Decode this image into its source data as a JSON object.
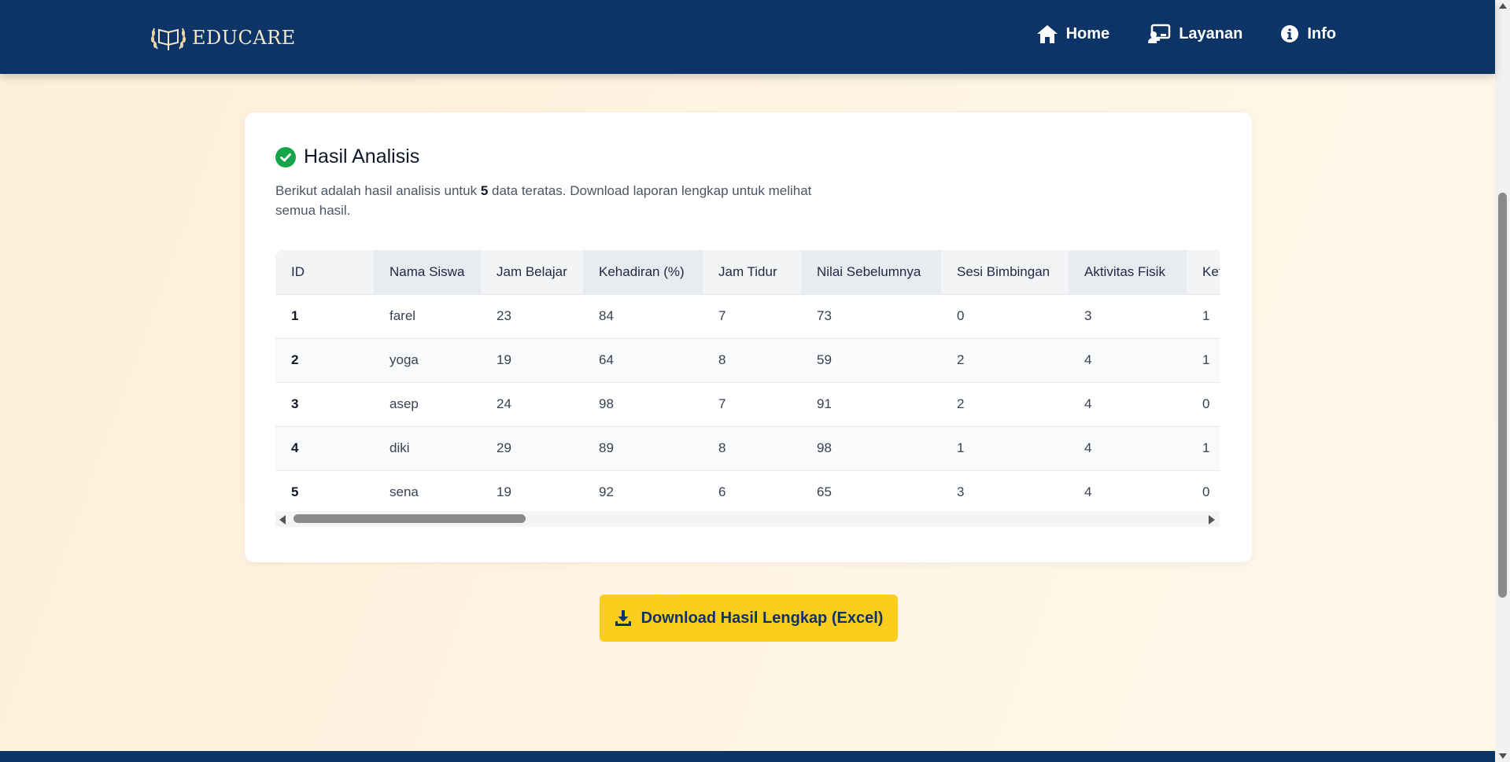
{
  "brand": {
    "name": "EDUCARE"
  },
  "nav": [
    {
      "label": "Home",
      "icon": "home-icon"
    },
    {
      "label": "Layanan",
      "icon": "teacher-board-icon"
    },
    {
      "label": "Info",
      "icon": "info-circle-icon"
    }
  ],
  "result": {
    "title": "Hasil Analisis",
    "desc_prefix": "Berikut adalah hasil analisis untuk ",
    "desc_count": "5",
    "desc_suffix": " data teratas. Download laporan lengkap untuk melihat semua hasil."
  },
  "table": {
    "headers": [
      "ID",
      "Nama Siswa",
      "Jam Belajar",
      "Kehadiran (%)",
      "Jam Tidur",
      "Nilai Sebelumnya",
      "Sesi Bimbingan",
      "Aktivitas Fisik",
      "Ket"
    ],
    "rows": [
      [
        "1",
        "farel",
        "23",
        "84",
        "7",
        "73",
        "0",
        "3",
        "1"
      ],
      [
        "2",
        "yoga",
        "19",
        "64",
        "8",
        "59",
        "2",
        "4",
        "1"
      ],
      [
        "3",
        "asep",
        "24",
        "98",
        "7",
        "91",
        "2",
        "4",
        "0"
      ],
      [
        "4",
        "diki",
        "29",
        "89",
        "8",
        "98",
        "1",
        "4",
        "1"
      ],
      [
        "5",
        "sena",
        "19",
        "92",
        "6",
        "65",
        "3",
        "4",
        "0"
      ]
    ]
  },
  "download": {
    "label": "Download Hasil Lengkap (Excel)",
    "icon": "download-icon"
  },
  "colors": {
    "navy": "#0c3466",
    "accent": "#fbcd1c",
    "success": "#16a34a"
  }
}
